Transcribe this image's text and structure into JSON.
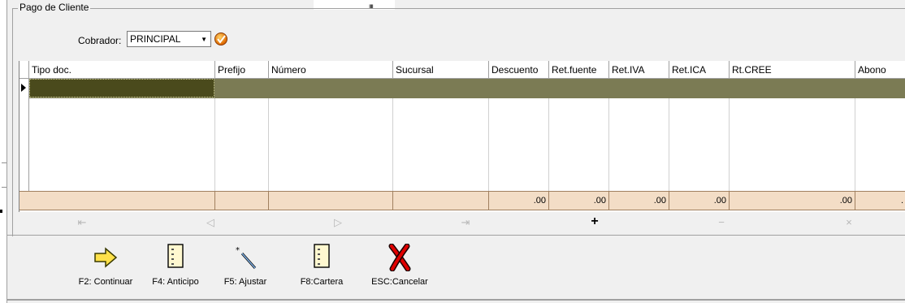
{
  "group": {
    "title": "Pago de Cliente"
  },
  "cobrador": {
    "label": "Cobrador:",
    "value": "PRINCIPAL"
  },
  "grid": {
    "columns": [
      "Tipo doc.",
      "Prefijo",
      "Número",
      "Sucursal",
      "Descuento",
      "Ret.fuente",
      "Ret.IVA",
      "Ret.ICA",
      "Rt.CREE",
      "Abono"
    ],
    "totals": [
      "",
      "",
      "",
      "",
      ".00",
      ".00",
      ".00",
      ".00",
      ".00",
      "."
    ]
  },
  "navigator": {
    "buttons": [
      "first",
      "prior",
      "next",
      "last",
      "insert",
      "delete",
      "cancel"
    ]
  },
  "toolbar": {
    "continuar": "F2: Continuar",
    "anticipo": "F4: Anticipo",
    "ajustar": "F5: Ajustar",
    "cartera": "F8:Cartera",
    "cancelar": "ESC:Cancelar"
  },
  "colors": {
    "selected_row": "#7b7b54",
    "totals_row": "#f3ddc6"
  }
}
